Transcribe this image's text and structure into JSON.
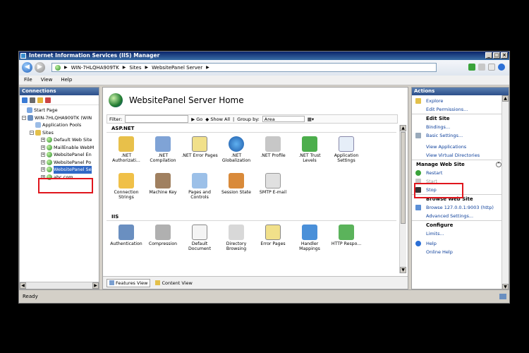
{
  "window": {
    "title": "Internet Information Services (IIS) Manager"
  },
  "address": {
    "crumbs": [
      "WIN-7HLQHA909TK",
      "Sites",
      "WebsitePanel Server"
    ]
  },
  "menu": {
    "items": [
      "File",
      "View",
      "Help"
    ]
  },
  "connections": {
    "title": "Connections",
    "tree": [
      "Start Page",
      "WIN-7HLQHA909TK (WIN",
      "Application Pools",
      "Sites",
      "Default Web Site",
      "MailEnable WebM",
      "WebsitePanel En",
      "WebsitePanel Po",
      "WebsitePanel Se",
      "abc.com"
    ]
  },
  "center": {
    "title": "WebsitePanel Server Home",
    "filter": {
      "label": "Filter:",
      "go": "Go",
      "show_all": "Show All",
      "group_by": "Group by:",
      "group_value": "Area"
    },
    "aspnet": {
      "heading": "ASP.NET",
      "row1": [
        ".NET Authorizati...",
        ".NET Compilation",
        ".NET Error Pages",
        ".NET Globalization",
        ".NET Profile",
        ".NET Trust Levels",
        "Application Settings"
      ],
      "row2": [
        "Connection Strings",
        "Machine Key",
        "Pages and Controls",
        "Session State",
        "SMTP E-mail"
      ]
    },
    "iis": {
      "heading": "IIS",
      "row1": [
        "Authentication",
        "Compression",
        "Default Document",
        "Directory Browsing",
        "Error Pages",
        "Handler Mappings",
        "HTTP Respo..."
      ]
    },
    "tabs": {
      "features": "Features View",
      "content": "Content View"
    }
  },
  "actions": {
    "title": "Actions",
    "explore": "Explore",
    "edit_permissions": "Edit Permissions...",
    "edit_site": "Edit Site",
    "bindings": "Bindings...",
    "basic_settings": "Basic Settings...",
    "view_applications": "View Applications",
    "view_virtual_dirs": "View Virtual Directories",
    "manage_web_site": "Manage Web Site",
    "restart": "Restart",
    "start": "Start",
    "stop": "Stop",
    "browse_web_site": "Browse Web Site",
    "browse_url": "Browse 127.0.0.1:9003 (http)",
    "advanced_settings": "Advanced Settings...",
    "configure": "Configure",
    "limits": "Limits...",
    "help": "Help",
    "online_help": "Online Help"
  },
  "status": {
    "text": "Ready"
  },
  "colors": {
    "highlight_box": "#e0161d",
    "selection": "#3169c6",
    "link": "#0b3e9a"
  }
}
